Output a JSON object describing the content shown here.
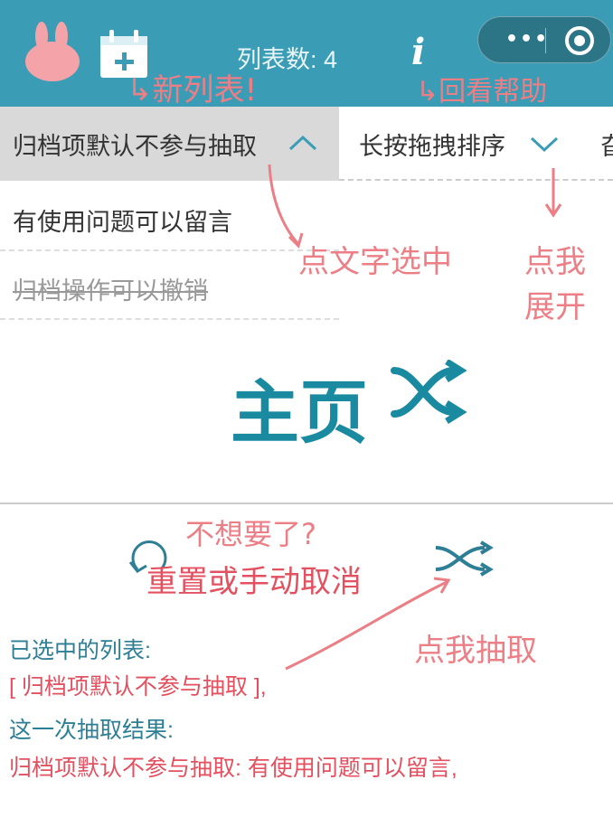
{
  "header": {
    "count_label": "列表数: 4",
    "info_icon": "i",
    "capsule_dots": "•••"
  },
  "tabs": [
    {
      "label": "归档项默认不参与抽取"
    },
    {
      "label": "长按拖拽排序"
    },
    {
      "label": "旮"
    }
  ],
  "list_items": [
    {
      "label": "有使用问题可以留言",
      "archived": false
    },
    {
      "label": "归档操作可以撤销",
      "archived": true
    }
  ],
  "result": {
    "selected_title": "已选中的列表:",
    "selected_value": "[ 归档项默认不参与抽取 ],",
    "draw_title": "这一次抽取结果:",
    "draw_value": "归档项默认不参与抽取: 有使用问题可以留言,"
  },
  "annotations": {
    "new_list": "↳新列表!",
    "view_help": "↳回看帮助",
    "click_select": "点文字选中",
    "click_expand_1": "点我",
    "click_expand_2": "展开",
    "home": "主页",
    "dont_want": "不想要了?",
    "reset_or": "重置或手动取消",
    "click_draw": "点我抽取"
  },
  "colors": {
    "header_bg": "#3a9db5",
    "accent_teal": "#2e7f95",
    "accent_red": "#e3505f",
    "annotation_pink": "#ec7e86",
    "logo_pink": "#f4a3a8"
  }
}
